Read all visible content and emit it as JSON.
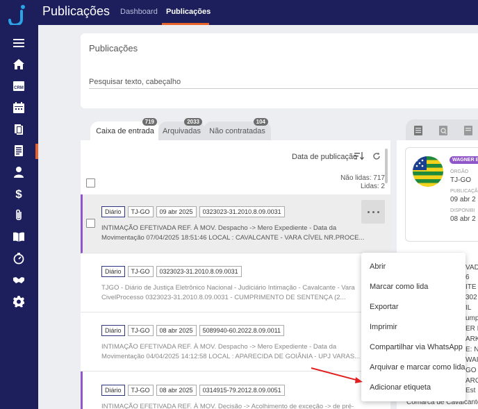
{
  "header": {
    "app_title": "Publicações",
    "nav": [
      "Dashboard",
      "Publicações"
    ],
    "active_nav": "Publicações"
  },
  "sidebar": {
    "icons": [
      "menu-icon",
      "home-icon",
      "crm-icon",
      "calendar-icon",
      "documents-icon",
      "publications-icon",
      "user-icon",
      "dollar-icon",
      "paperclip-icon",
      "book-icon",
      "timer-icon",
      "handshake-icon",
      "settings-icon"
    ],
    "crm_label": "CRM"
  },
  "search": {
    "title": "Publicações",
    "placeholder": "Pesquisar texto, cabeçalho"
  },
  "tabs": [
    {
      "label": "Caixa de entrada",
      "count": "719"
    },
    {
      "label": "Arquivadas",
      "count": "2033"
    },
    {
      "label": "Não contratadas",
      "count": "104"
    }
  ],
  "list": {
    "sort_label": "Data de publicação",
    "unread": "Não lidas: 717",
    "read": "Lidas: 2",
    "items": [
      {
        "source": "Diário",
        "court": "TJ-GO",
        "date": "09 abr 2025",
        "process": "0323023-31.2010.8.09.0031",
        "text": "INTIMAÇÃO EFETIVADA REF. À MOV. Despacho -> Mero Expediente - Data da Movimentação 07/04/2025 18:51:46 LOCAL : CAVALCANTE - VARA CÍVEL NR.PROCE..."
      },
      {
        "source": "Diário",
        "court": "TJ-GO",
        "date": "",
        "process": "0323023-31.2010.8.09.0031",
        "text": "TJGO - Diário de Justiça Eletrônico Nacional - Judiciário Intimação - Cavalcante - Vara CivelProcesso 0323023-31.2010.8.09.0031 - CUMPRIMENTO DE SENTENÇA (2..."
      },
      {
        "source": "Diário",
        "court": "TJ-GO",
        "date": "08 abr 2025",
        "process": "5089940-60.2022.8.09.0011",
        "text": "INTIMAÇÃO EFETIVADA REF. À MOV. Despacho -> Mero Expediente - Data da Movimentação 04/04/2025 14:12:58 LOCAL : APARECIDA DE GOIÂNIA - UPJ VARAS..."
      },
      {
        "source": "Diário",
        "court": "TJ-GO",
        "date": "08 abr 2025",
        "process": "0314915-79.2012.8.09.0051",
        "text": "INTIMAÇÃO EFETIVADA REF. À MOV. Decisão -> Acolhimento de exceção -> de pré- executividade"
      }
    ]
  },
  "detail": {
    "author_badge": "WAGNER B",
    "orgao_label": "ÓRGÃO",
    "orgao_value": "TJ-GO",
    "publicacao_label": "PUBLICAÇÃ",
    "publicacao_value": "09 abr 2",
    "disponibilizacao_label": "DISPONIBI",
    "disponibilizacao_value": "08 abr 2",
    "background_lines": [
      "VADA",
      "6",
      "ITE -",
      "302",
      "IL",
      "ump",
      "ER I",
      "ARK",
      "Ε: ΝΑ",
      "WAI",
      "GO",
      "ARO",
      "Est",
      "Comarca de Cavalcante"
    ]
  },
  "context_menu": {
    "items": [
      "Abrir",
      "Marcar como lida",
      "Exportar",
      "Imprimir",
      "Compartilhar via WhatsApp",
      "Arquivar e marcar como lida",
      "Adicionar etiqueta"
    ]
  },
  "colors": {
    "navy": "#1c1f5c",
    "accent_orange": "#e8622c",
    "selection_purple": "#8f56c9",
    "annotation_red": "#e02020"
  }
}
